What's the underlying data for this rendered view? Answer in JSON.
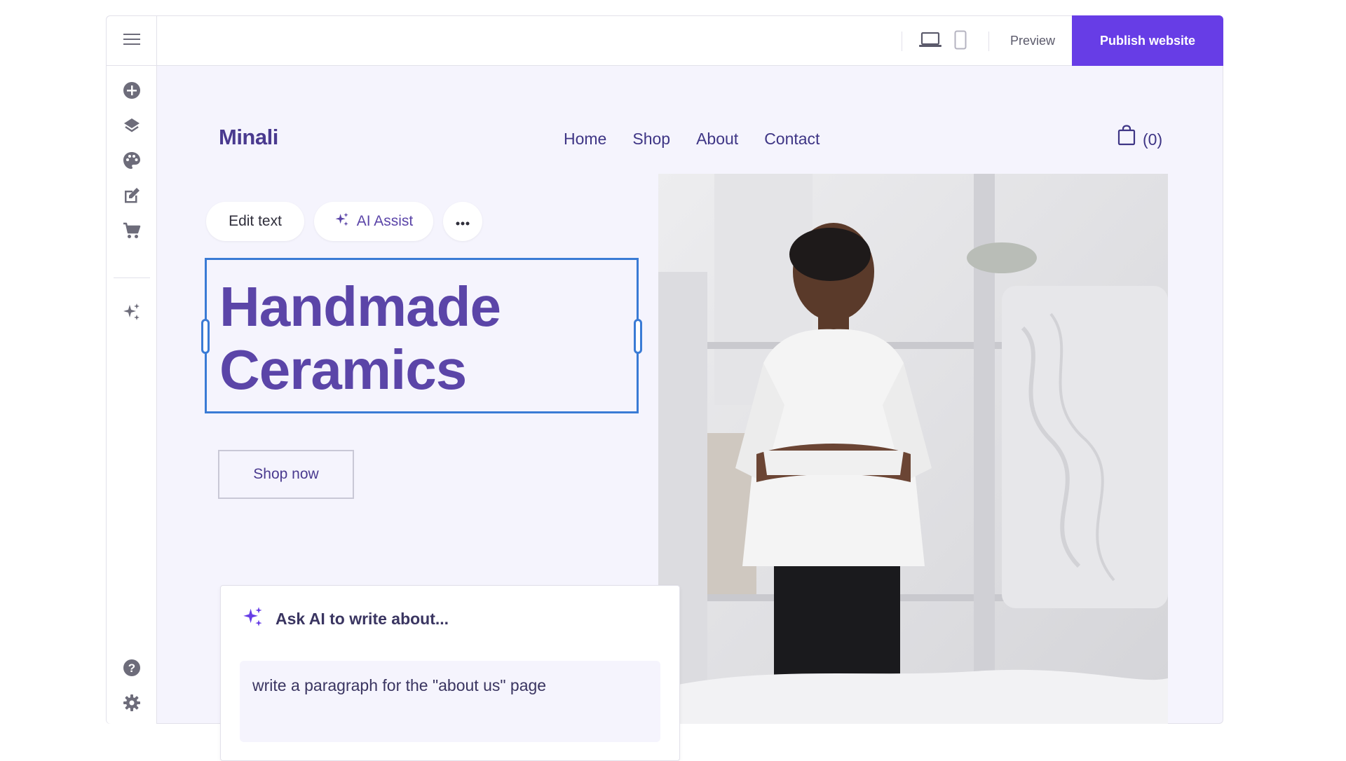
{
  "topbar": {
    "menu_icon": "hamburger-menu-icon",
    "desktop_icon": "desktop-view-icon",
    "mobile_icon": "mobile-view-icon",
    "preview_label": "Preview",
    "publish_label": "Publish website",
    "accent_color": "#673de6"
  },
  "left_toolbar": {
    "items": [
      {
        "icon": "add-icon"
      },
      {
        "icon": "layers-icon"
      },
      {
        "icon": "palette-icon"
      },
      {
        "icon": "edit-page-icon"
      },
      {
        "icon": "cart-icon"
      },
      {
        "icon": "ai-sparkle-icon"
      }
    ],
    "bottom_items": [
      {
        "icon": "help-icon"
      },
      {
        "icon": "settings-icon"
      }
    ]
  },
  "site": {
    "logo": "Minali",
    "nav": [
      "Home",
      "Shop",
      "About",
      "Contact"
    ],
    "cart_count": "(0)",
    "headline": "Handmade\nCeramics",
    "cta_label": "Shop now",
    "text_color": "#5b45a8"
  },
  "text_toolbar": {
    "edit_label": "Edit text",
    "ai_assist_label": "AI Assist",
    "more_icon": "more-horizontal-icon"
  },
  "ai_panel": {
    "title": "Ask AI to write about...",
    "input_value": "write a paragraph for the \"about us\" page"
  },
  "hero_image": {
    "subject": "ceramics-artist-photo"
  }
}
